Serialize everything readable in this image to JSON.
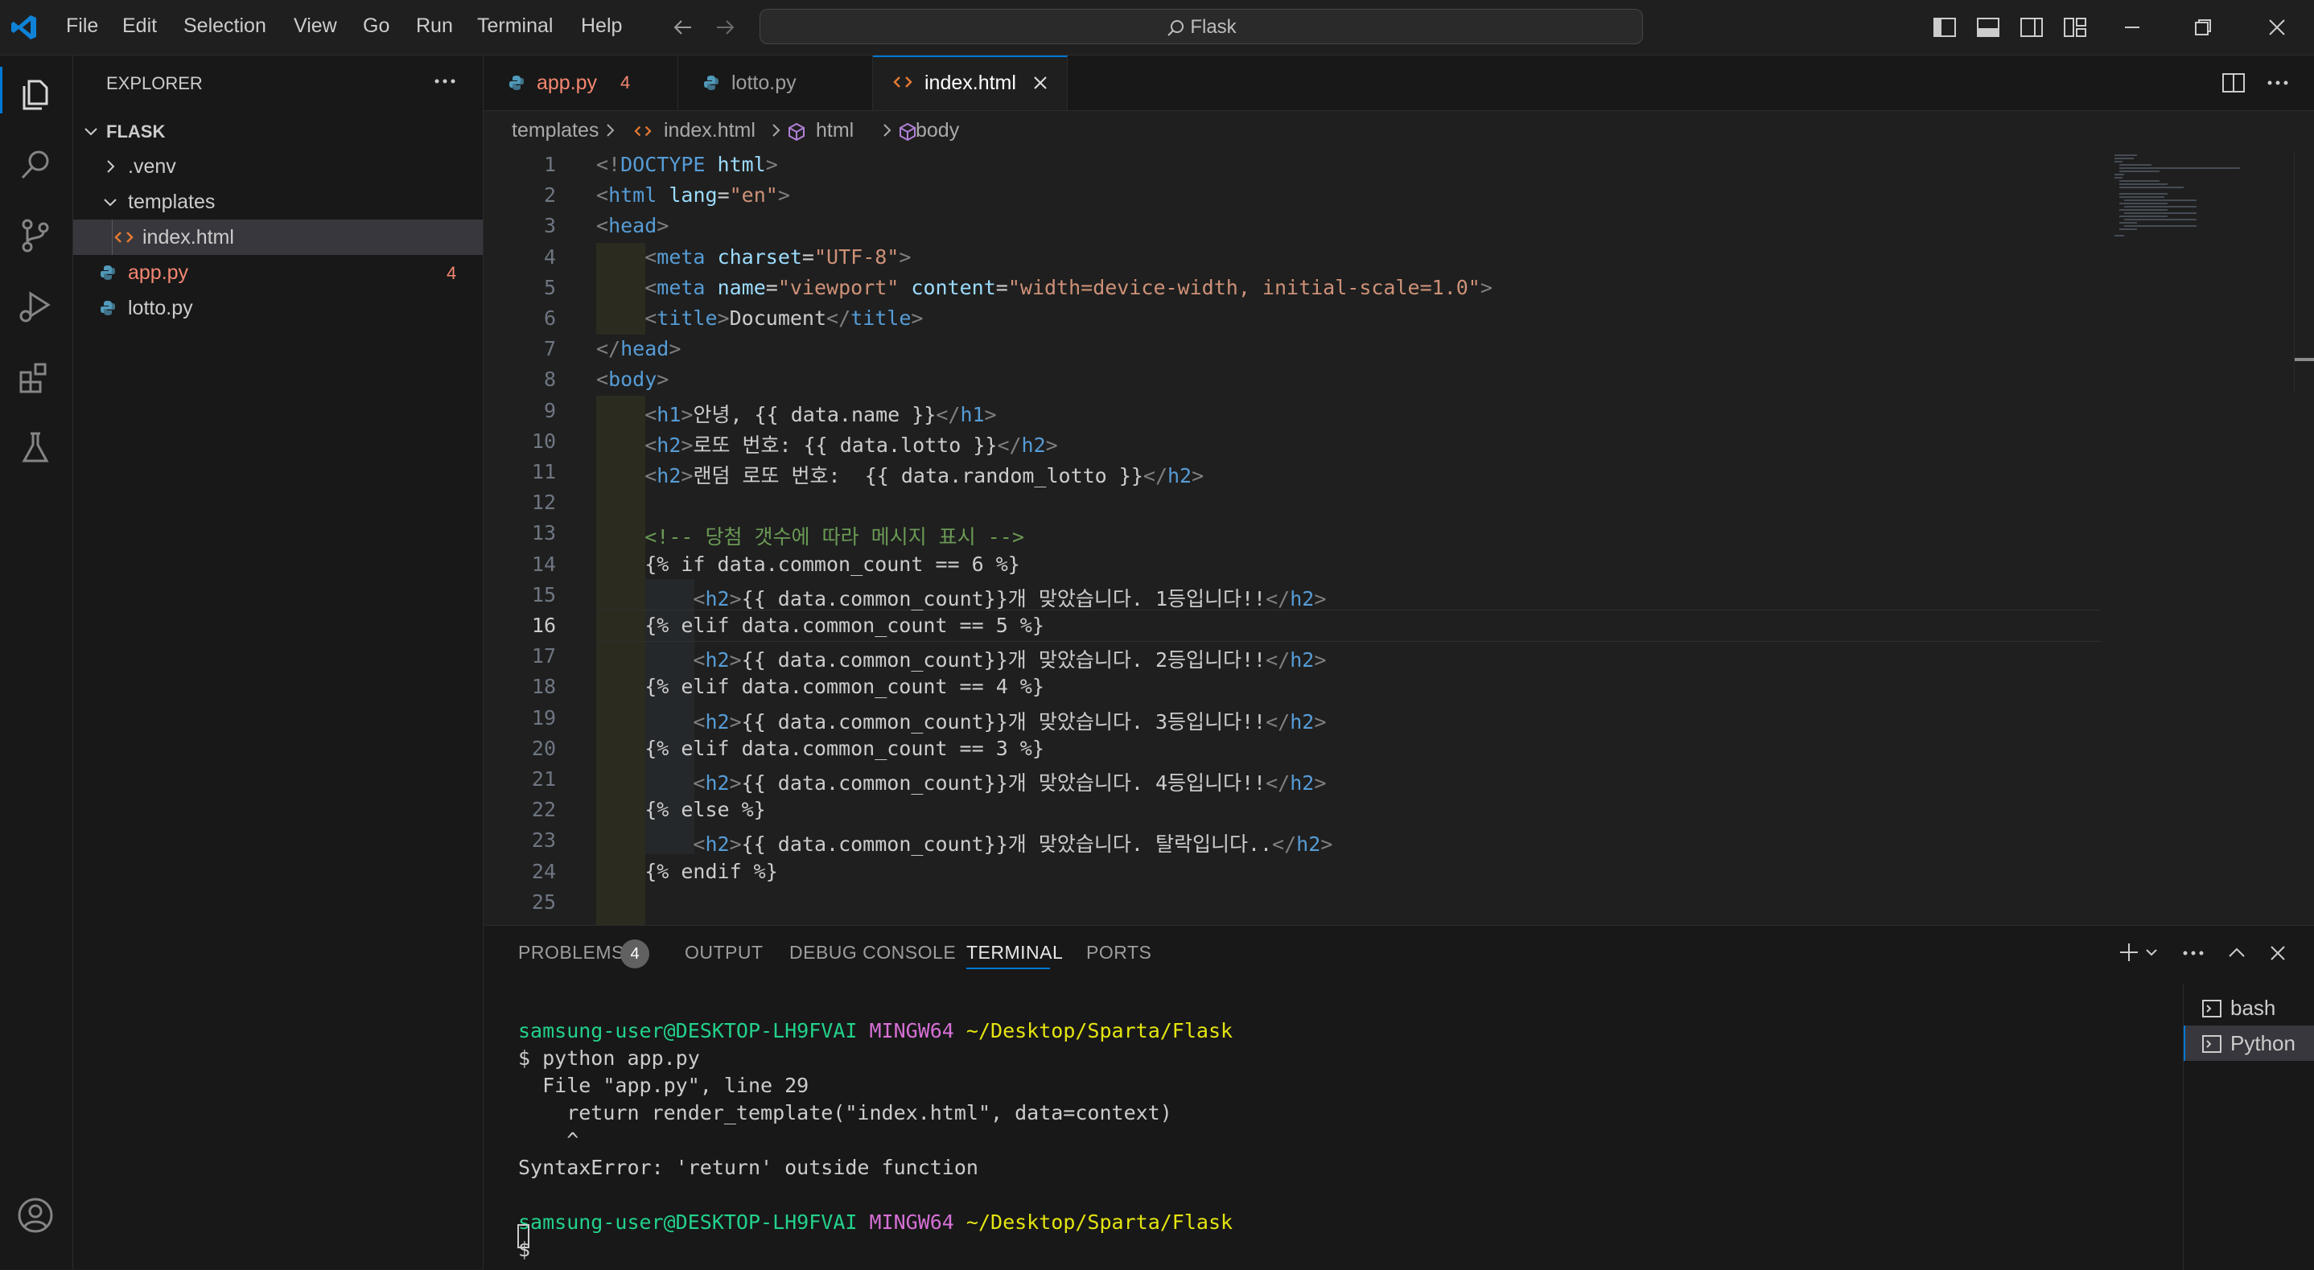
{
  "titlebar": {
    "menu": [
      "File",
      "Edit",
      "Selection",
      "View",
      "Go",
      "Run",
      "Terminal",
      "Help"
    ],
    "search_text": "Flask"
  },
  "explorer": {
    "header": "EXPLORER",
    "folder": "FLASK",
    "items": [
      {
        "label": ".venv",
        "type": "folder",
        "expanded": false
      },
      {
        "label": "templates",
        "type": "folder",
        "expanded": true
      },
      {
        "label": "index.html",
        "type": "html",
        "selected": true
      },
      {
        "label": "app.py",
        "type": "python",
        "badge": "4",
        "error": true
      },
      {
        "label": "lotto.py",
        "type": "python"
      }
    ]
  },
  "tabs": [
    {
      "label": "app.py",
      "badge": "4",
      "active": false
    },
    {
      "label": "lotto.py",
      "active": false
    },
    {
      "label": "index.html",
      "active": true
    }
  ],
  "breadcrumb": [
    "templates",
    "index.html",
    "html",
    "body"
  ],
  "editor": {
    "current_line": 16,
    "lines": [
      {
        "n": "1",
        "t": "<!DOCTYPE html>"
      },
      {
        "n": "2",
        "t": "<html lang=\"en\">"
      },
      {
        "n": "3",
        "t": "<head>"
      },
      {
        "n": "4",
        "t": "    <meta charset=\"UTF-8\">"
      },
      {
        "n": "5",
        "t": "    <meta name=\"viewport\" content=\"width=device-width, initial-scale=1.0\">"
      },
      {
        "n": "6",
        "t": "    <title>Document</title>"
      },
      {
        "n": "7",
        "t": "</head>"
      },
      {
        "n": "8",
        "t": "<body>"
      },
      {
        "n": "9",
        "t": "    <h1>안녕, {{ data.name }}</h1>"
      },
      {
        "n": "10",
        "t": "    <h2>로또 번호: {{ data.lotto }}</h2>"
      },
      {
        "n": "11",
        "t": "    <h2>랜덤 로또 번호:  {{ data.random_lotto }}</h2>"
      },
      {
        "n": "12",
        "t": ""
      },
      {
        "n": "13",
        "t": "    <!-- 당첨 갯수에 따라 메시지 표시 -->"
      },
      {
        "n": "14",
        "t": "    {% if data.common_count == 6 %}"
      },
      {
        "n": "15",
        "t": "        <h2>{{ data.common_count}}개 맞았습니다. 1등입니다!!</h2>"
      },
      {
        "n": "16",
        "t": "    {% elif data.common_count == 5 %}"
      },
      {
        "n": "17",
        "t": "        <h2>{{ data.common_count}}개 맞았습니다. 2등입니다!!</h2>"
      },
      {
        "n": "18",
        "t": "    {% elif data.common_count == 4 %}"
      },
      {
        "n": "19",
        "t": "        <h2>{{ data.common_count}}개 맞았습니다. 3등입니다!!</h2>"
      },
      {
        "n": "20",
        "t": "    {% elif data.common_count == 3 %}"
      },
      {
        "n": "21",
        "t": "        <h2>{{ data.common_count}}개 맞았습니다. 4등입니다!!</h2>"
      },
      {
        "n": "22",
        "t": "    {% else %}"
      },
      {
        "n": "23",
        "t": "        <h2>{{ data.common_count}}개 맞았습니다. 탈락입니다..</h2>"
      },
      {
        "n": "24",
        "t": "    {% endif %}"
      },
      {
        "n": "25",
        "t": ""
      }
    ]
  },
  "panel": {
    "tabs": [
      "PROBLEMS",
      "OUTPUT",
      "DEBUG CONSOLE",
      "TERMINAL",
      "PORTS"
    ],
    "problems_count": "4",
    "active_tab": "TERMINAL",
    "terminal_lines": [
      {
        "user": "samsung-user@DESKTOP-LH9FVAI",
        "host": "MINGW64",
        "path": "~/Desktop/Sparta/Flask"
      },
      {
        "text": "$ python app.py"
      },
      {
        "text": "  File \"app.py\", line 29"
      },
      {
        "text": "    return render_template(\"index.html\", data=context)"
      },
      {
        "text": "    ^"
      },
      {
        "text": "SyntaxError: 'return' outside function"
      },
      {
        "text": ""
      },
      {
        "user": "samsung-user@DESKTOP-LH9FVAI",
        "host": "MINGW64",
        "path": "~/Desktop/Sparta/Flask"
      },
      {
        "text": "$ "
      }
    ],
    "terminals": [
      "bash",
      "Python"
    ]
  },
  "colors": {
    "accent": "#0078d4",
    "error": "#f48771",
    "html_icon": "#e37933",
    "python_icon": "#519aba"
  }
}
